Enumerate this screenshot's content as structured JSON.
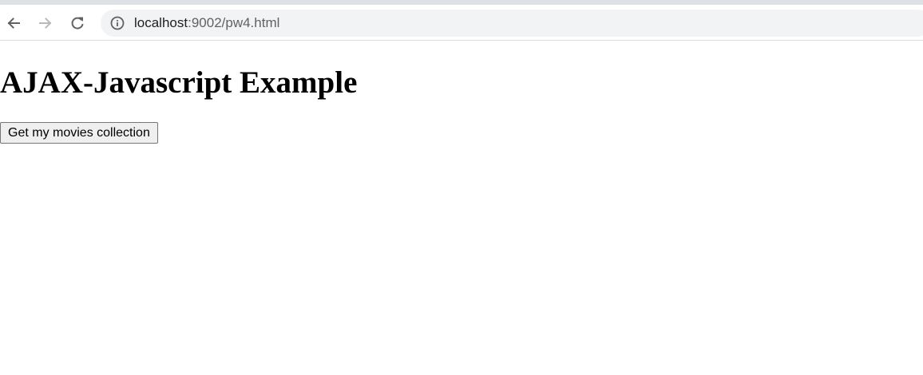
{
  "browser": {
    "address_bar": {
      "host": "localhost",
      "path": ":9002/pw4.html"
    },
    "icons": {
      "back": "back-arrow-icon",
      "forward": "forward-arrow-icon",
      "reload": "reload-icon",
      "site_info": "info-icon"
    }
  },
  "page": {
    "title": "AJAX-Javascript Example",
    "button_label": "Get my movies collection"
  }
}
